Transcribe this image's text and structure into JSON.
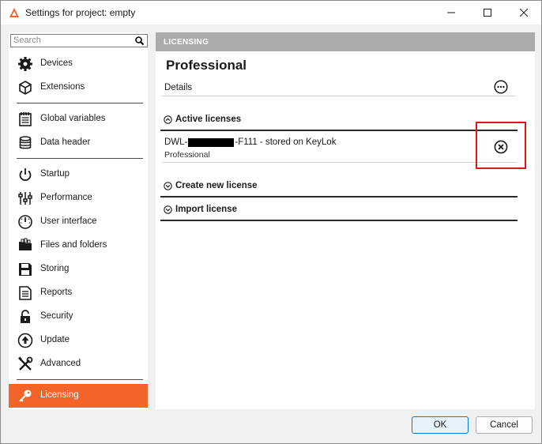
{
  "window": {
    "title": "Settings for project: empty",
    "controls": [
      "minimize",
      "maximize",
      "close"
    ]
  },
  "sidebar": {
    "search": {
      "placeholder": "Search",
      "value": ""
    },
    "groups": [
      [
        {
          "label": "Devices",
          "icon": "gear-icon"
        },
        {
          "label": "Extensions",
          "icon": "cube-icon"
        }
      ],
      [
        {
          "label": "Global variables",
          "icon": "notepad-icon"
        },
        {
          "label": "Data header",
          "icon": "database-icon"
        }
      ],
      [
        {
          "label": "Startup",
          "icon": "power-icon"
        },
        {
          "label": "Performance",
          "icon": "sliders-icon"
        },
        {
          "label": "User interface",
          "icon": "gauge-icon"
        },
        {
          "label": "Files and folders",
          "icon": "folder-icon"
        },
        {
          "label": "Storing",
          "icon": "floppy-disk-icon"
        },
        {
          "label": "Reports",
          "icon": "document-icon"
        },
        {
          "label": "Security",
          "icon": "padlock-icon"
        },
        {
          "label": "Update",
          "icon": "upload-circle-icon"
        },
        {
          "label": "Advanced",
          "icon": "tools-icon"
        }
      ],
      [
        {
          "label": "Licensing",
          "icon": "key-icon",
          "active": true
        }
      ]
    ]
  },
  "main": {
    "header": "LICENSING",
    "title": "Professional",
    "details_label": "Details",
    "sections": {
      "active": "Active licenses",
      "create": "Create new license",
      "import": "Import license"
    },
    "license": {
      "key_prefix": "DWL-",
      "key_suffix": "-F111 - stored on KeyLok",
      "type": "Professional"
    }
  },
  "footer": {
    "ok": "OK",
    "cancel": "Cancel"
  },
  "colors": {
    "accent": "#f2642a",
    "highlight": "#e0161a",
    "header_bg": "#ababab"
  }
}
